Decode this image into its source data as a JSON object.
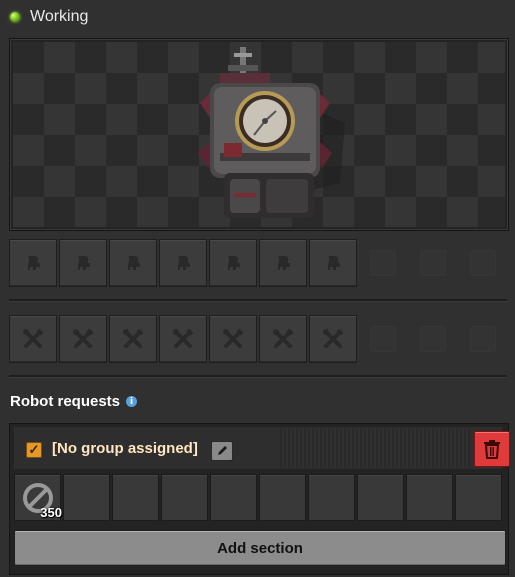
{
  "status": {
    "text": "Working",
    "color": "#7cc520"
  },
  "preview": {
    "icon": "roboport-machine-icon"
  },
  "robot_slots": {
    "filled_count": 7,
    "empty_count": 3,
    "icon": "construction-robot-icon"
  },
  "repair_slots": {
    "filled_count": 7,
    "empty_count": 3,
    "icon": "repair-pack-icon"
  },
  "robot_requests": {
    "title": "Robot requests",
    "info_icon": "info-icon",
    "info_glyph": "i",
    "group": {
      "checked": true,
      "name": "[No group assigned]",
      "edit_icon": "pencil-icon",
      "delete_icon": "trash-icon"
    },
    "slots": [
      {
        "icon": "blocked-icon",
        "count": "350"
      },
      {},
      {},
      {},
      {},
      {},
      {},
      {},
      {},
      {}
    ],
    "add_section_label": "Add section"
  },
  "colors": {
    "delete_button": "#e03a3a",
    "checkbox": "#e39827"
  }
}
